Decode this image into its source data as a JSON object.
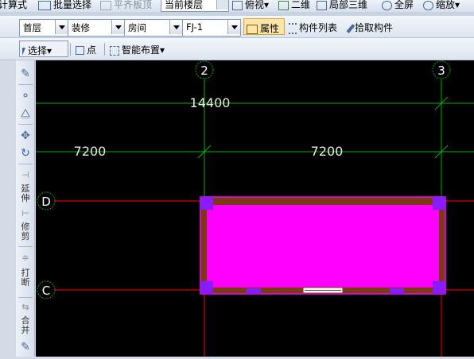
{
  "top_toolbar": {
    "calc_label": "计算式",
    "batch_select_label": "批量选择",
    "align_slab_label": "平齐板顶",
    "current_floor_label": "当前楼层",
    "top_view_label": "俯视",
    "view_2d_label": "二维",
    "local_3d_label": "局部三维",
    "fullscreen_label": "全屏",
    "zoom_label": "缩放"
  },
  "close_glyph": "×",
  "selectors": {
    "floor": "首层",
    "category": "装修",
    "element_type": "房间",
    "component": "FJ-1"
  },
  "component_toolbar": {
    "properties_label": "属性",
    "component_list_label": "构件列表",
    "pick_component_label": "拾取构件"
  },
  "draw_toolbar": {
    "select_label": "选择",
    "point_label": "点",
    "smart_layout_label": "智能布置"
  },
  "side_toolbar": {
    "extend_label": "延伸",
    "trim_label": "修剪",
    "break_label": "打断",
    "merge_label": "合并"
  },
  "drawing": {
    "axis_2": "2",
    "axis_3": "3",
    "axis_d": "D",
    "axis_c": "C",
    "dim_total": "14400",
    "dim_left": "7200",
    "dim_right": "7200",
    "colors": {
      "background": "#000000",
      "axis_line": "#ff0000",
      "dim_line": "#00b000",
      "room_fill": "#ff00ff",
      "wall": "#7a3a14",
      "grip": "#8a1aff"
    }
  }
}
